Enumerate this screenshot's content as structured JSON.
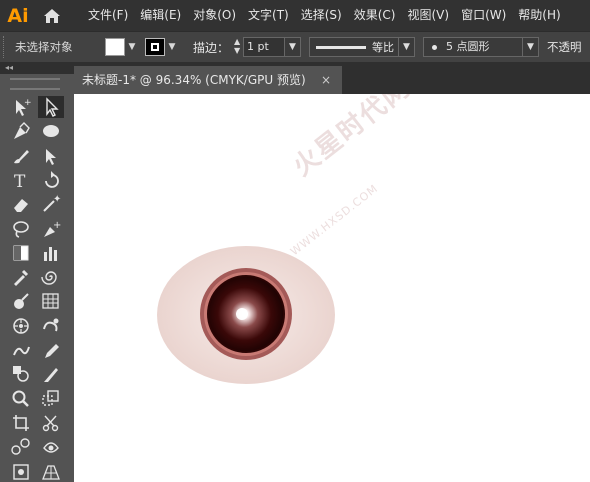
{
  "app": {
    "logo_text": "Ai"
  },
  "menu": [
    "文件(F)",
    "编辑(E)",
    "对象(O)",
    "文字(T)",
    "选择(S)",
    "效果(C)",
    "视图(V)",
    "窗口(W)",
    "帮助(H)"
  ],
  "control_bar": {
    "selection_label": "未选择对象",
    "stroke_label": "描边：",
    "stroke_weight": "1 pt",
    "stroke_profile": "等比",
    "brush": "5 点圆形",
    "opacity_label": "不透明"
  },
  "document_tab": {
    "title": "未标题-1* @ 96.34% (CMYK/GPU 预览)",
    "close": "×"
  },
  "canvas": {
    "watermark_main": "火星时代网",
    "watermark_url": "WWW.HXSD.COM",
    "colors": {
      "sclera": "#f0dcd8",
      "iris_ring": "#c06b6b",
      "iris_dark": "#3a0a0a",
      "highlight": "#ffffff"
    }
  },
  "toolbox_icons": [
    "anchor-point-tool-icon",
    "direct-selection-tool-icon",
    "pen-tool-icon",
    "ellipse-tool-icon",
    "paintbrush-tool-icon",
    "direct-select-arrow-icon",
    "type-tool-icon",
    "rotate-tool-icon",
    "eraser-tool-icon",
    "magic-wand-tool-icon",
    "lasso-tool-icon",
    "pen-add-anchor-icon",
    "gradient-tool-icon",
    "column-graph-tool-icon",
    "eyedropper-tool-icon",
    "spiral-tool-icon",
    "blob-brush-tool-icon",
    "mesh-tool-icon",
    "symbol-sprayer-icon",
    "shaper-tool-icon",
    "puppet-warp-tool-icon",
    "pencil-tool-icon",
    "shape-builder-tool-icon",
    "knife-tool-icon",
    "zoom-tool-icon",
    "scale-tool-icon",
    "artboard-tool-icon",
    "scissors-tool-icon",
    "blend-tool-icon",
    "live-paint-tool-icon",
    "free-transform-tool-icon",
    "perspective-grid-tool-icon"
  ]
}
